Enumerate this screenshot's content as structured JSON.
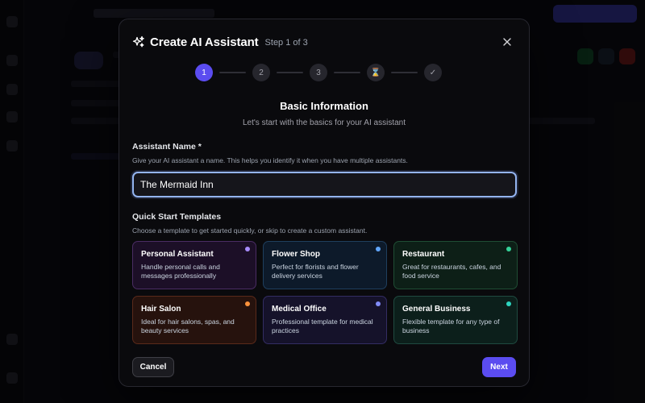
{
  "theme": {
    "accent": "#5b4cf0",
    "focus_border": "#93b4f0"
  },
  "modal": {
    "title": "Create AI Assistant",
    "step_indicator": "Step 1 of 3",
    "icons": {
      "title_icon": "sparkle-icon",
      "close": "close-icon"
    }
  },
  "stepper": {
    "steps": [
      {
        "label": "1",
        "state": "active"
      },
      {
        "label": "2",
        "state": "upcoming"
      },
      {
        "label": "3",
        "state": "upcoming"
      },
      {
        "label": "⌛",
        "state": "upcoming",
        "icon": "hourglass-icon"
      },
      {
        "label": "✓",
        "state": "upcoming",
        "icon": "check-icon"
      }
    ]
  },
  "section": {
    "title": "Basic Information",
    "subtitle": "Let's start with the basics for your AI assistant"
  },
  "name_field": {
    "label": "Assistant Name *",
    "help": "Give your AI assistant a name. This helps you identify it when you have multiple assistants.",
    "value": "The Mermaid Inn"
  },
  "templates": {
    "label": "Quick Start Templates",
    "help": "Choose a template to get started quickly, or skip to create a custom assistant.",
    "items": [
      {
        "name": "Personal Assistant",
        "description": "Handle personal calls and messages professionally",
        "bg": "#1c0f27",
        "border": "#4a2c63",
        "dot": "#a78bfa"
      },
      {
        "name": "Flower Shop",
        "description": "Perfect for florists and flower delivery services",
        "bg": "#0d1a2a",
        "border": "#1f3f5e",
        "dot": "#60a5fa"
      },
      {
        "name": "Restaurant",
        "description": "Great for restaurants, cafes, and food service",
        "bg": "#0d1f17",
        "border": "#1f4d34",
        "dot": "#34d399"
      },
      {
        "name": "Hair Salon",
        "description": "Ideal for hair salons, spas, and beauty services",
        "bg": "#26120d",
        "border": "#5a2a1a",
        "dot": "#fb923c"
      },
      {
        "name": "Medical Office",
        "description": "Professional template for medical practices",
        "bg": "#15122a",
        "border": "#332d63",
        "dot": "#818cf8"
      },
      {
        "name": "General Business",
        "description": "Flexible template for any type of business",
        "bg": "#0c1f1b",
        "border": "#1f4a40",
        "dot": "#2dd4bf"
      }
    ]
  },
  "footer": {
    "cancel_label": "Cancel",
    "next_label": "Next"
  }
}
